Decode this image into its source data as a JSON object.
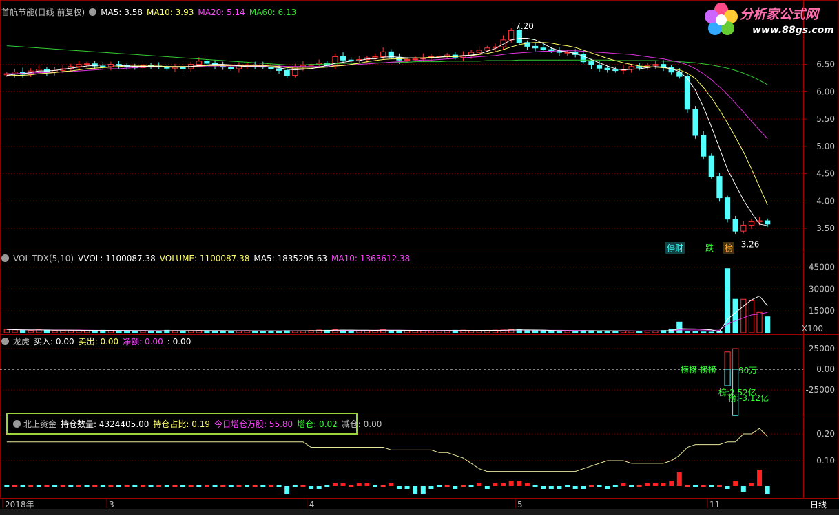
{
  "main": {
    "stock": "首航节能(日线 前复权)",
    "ma_labels": [
      {
        "text": "MA5: 3.58",
        "color": "#ffffff"
      },
      {
        "text": "MA10: 3.93",
        "color": "#ffff66"
      },
      {
        "text": "MA20: 5.14",
        "color": "#ff44ff"
      },
      {
        "text": "MA60: 6.13",
        "color": "#33dd33"
      }
    ],
    "high_label": "7.20",
    "low_label": "3.26",
    "tags": [
      {
        "text": "停财",
        "color": "#33ffff"
      },
      {
        "text": "跌",
        "color": "#33ff33"
      },
      {
        "text": "榜",
        "color": "#ffaa33"
      }
    ],
    "y_ticks": [
      "6.50",
      "6.00",
      "5.50",
      "5.00",
      "4.50",
      "4.00",
      "3.50"
    ]
  },
  "volume": {
    "title": "VOL-TDX(5,10)",
    "labels": [
      {
        "text": "VVOL: 1100087.38",
        "color": "#ffffff"
      },
      {
        "text": "VOLUME: 1100087.38",
        "color": "#ffff66"
      },
      {
        "text": "MA5: 1835295.63",
        "color": "#ffffff"
      },
      {
        "text": "MA10: 1363612.38",
        "color": "#ff44ff"
      }
    ],
    "y_ticks": [
      "45000",
      "30000",
      "15000"
    ],
    "unit": "X100"
  },
  "longhu": {
    "title": "龙虎",
    "labels": [
      {
        "text": "买入: 0.00",
        "color": "#ffffff"
      },
      {
        "text": "卖出: 0.00",
        "color": "#ffff66"
      },
      {
        "text": "净额: 0.00",
        "color": "#ff44ff"
      },
      {
        "text": ": 0.00",
        "color": "#ffffff"
      }
    ],
    "y_ticks": [
      "25000",
      "0.00",
      "-25000"
    ],
    "annotations": [
      {
        "text": "榜:2.52亿",
        "color": "#33ff33"
      },
      {
        "text": "榜:-3.12亿",
        "color": "#33ff33"
      },
      {
        "text": "榜榜 榜榜",
        "color": "#33ff33"
      },
      {
        "text": "90万",
        "color": "#33ff33"
      }
    ]
  },
  "north": {
    "title": "北上资金",
    "labels": [
      {
        "text": "持仓数量: 4324405.00",
        "color": "#ffffff"
      },
      {
        "text": "持仓占比: 0.19",
        "color": "#ffff66"
      },
      {
        "text": "今日增仓万股: 55.80",
        "color": "#ff44ff"
      },
      {
        "text": "增仓: 0.02",
        "color": "#33ff33"
      },
      {
        "text": "减仓: 0.00",
        "color": "#c0c0c0"
      }
    ],
    "y_ticks": [
      "0.20",
      "0.10"
    ]
  },
  "x_axis": {
    "labels": [
      {
        "text": "2018年",
        "day": 0
      },
      {
        "text": "3",
        "day": 13
      },
      {
        "text": "4",
        "day": 38
      },
      {
        "text": "5",
        "day": 64
      },
      {
        "text": "11",
        "day": 88
      }
    ],
    "period": "日线"
  },
  "logo": {
    "name": "分析家公式网",
    "url": "www.88gs.com"
  },
  "chart_data": {
    "type": "candlestick",
    "title": "首航节能(日线 前复权)",
    "ylim": [
      3.15,
      7.3
    ],
    "close": [
      6.33,
      6.36,
      6.32,
      6.38,
      6.41,
      6.36,
      6.39,
      6.42,
      6.46,
      6.5,
      6.51,
      6.47,
      6.46,
      6.5,
      6.48,
      6.45,
      6.44,
      6.48,
      6.47,
      6.46,
      6.43,
      6.45,
      6.42,
      6.5,
      6.56,
      6.52,
      6.47,
      6.45,
      6.42,
      6.47,
      6.49,
      6.47,
      6.45,
      6.42,
      6.39,
      6.3,
      6.45,
      6.48,
      6.5,
      6.52,
      6.48,
      6.64,
      6.58,
      6.57,
      6.59,
      6.62,
      6.64,
      6.73,
      6.63,
      6.58,
      6.59,
      6.6,
      6.62,
      6.64,
      6.65,
      6.67,
      6.63,
      6.66,
      6.72,
      6.76,
      6.8,
      6.82,
      6.95,
      7.12,
      6.9,
      6.83,
      6.8,
      6.77,
      6.75,
      6.72,
      6.72,
      6.68,
      6.55,
      6.49,
      6.43,
      6.4,
      6.39,
      6.41,
      6.46,
      6.44,
      6.48,
      6.5,
      6.44,
      6.36,
      6.28,
      5.68,
      5.2,
      4.82,
      4.45,
      4.06,
      3.67,
      3.45,
      3.56,
      3.62,
      3.64,
      3.58
    ],
    "volume_x100": [
      2300,
      2000,
      1800,
      1600,
      2100,
      1900,
      1500,
      1700,
      1600,
      1800,
      1500,
      1400,
      1700,
      1600,
      1500,
      1400,
      1300,
      1500,
      1400,
      1300,
      1700,
      1500,
      1400,
      1500,
      1600,
      1500,
      1400,
      1300,
      1200,
      1400,
      1500,
      1300,
      1200,
      1300,
      1200,
      1500,
      1300,
      1400,
      1600,
      1900,
      1700,
      2100,
      1800,
      1700,
      1600,
      1500,
      1700,
      2200,
      1600,
      1500,
      1400,
      1500,
      1600,
      1400,
      1500,
      1600,
      1700,
      1800,
      1500,
      1600,
      1700,
      1800,
      1900,
      2300,
      2100,
      1700,
      1500,
      1400,
      1300,
      1200,
      1300,
      1400,
      1600,
      1500,
      1400,
      1200,
      1100,
      1300,
      1200,
      1100,
      1300,
      1200,
      1600,
      2600,
      7400,
      900,
      700,
      600,
      500,
      800,
      44000,
      23000,
      23000,
      22000,
      14000,
      11000
    ],
    "ma5": [
      6.3,
      6.32,
      6.33,
      6.35,
      6.38,
      6.38,
      6.39,
      6.41,
      6.43,
      6.45,
      6.47,
      6.48,
      6.49,
      6.49,
      6.48,
      6.47,
      6.46,
      6.46,
      6.46,
      6.46,
      6.45,
      6.45,
      6.45,
      6.46,
      6.48,
      6.49,
      6.5,
      6.5,
      6.49,
      6.47,
      6.46,
      6.46,
      6.46,
      6.45,
      6.44,
      6.41,
      6.4,
      6.41,
      6.42,
      6.45,
      6.48,
      6.52,
      6.54,
      6.56,
      6.57,
      6.6,
      6.6,
      6.63,
      6.64,
      6.63,
      6.62,
      6.62,
      6.61,
      6.62,
      6.63,
      6.65,
      6.65,
      6.66,
      6.67,
      6.69,
      6.74,
      6.79,
      6.87,
      6.95,
      6.98,
      6.98,
      6.95,
      6.88,
      6.8,
      6.75,
      6.73,
      6.7,
      6.65,
      6.59,
      6.53,
      6.47,
      6.42,
      6.4,
      6.41,
      6.42,
      6.44,
      6.46,
      6.45,
      6.42,
      6.37,
      6.24,
      6.03,
      5.72,
      5.36,
      4.97,
      4.58,
      4.3,
      4.02,
      3.79,
      3.58,
      3.55
    ],
    "ma10": [
      6.29,
      6.3,
      6.3,
      6.31,
      6.33,
      6.34,
      6.35,
      6.37,
      6.38,
      6.4,
      6.42,
      6.43,
      6.44,
      6.45,
      6.46,
      6.47,
      6.47,
      6.47,
      6.47,
      6.47,
      6.46,
      6.46,
      6.46,
      6.46,
      6.47,
      6.48,
      6.48,
      6.48,
      6.48,
      6.48,
      6.48,
      6.48,
      6.48,
      6.47,
      6.46,
      6.44,
      6.43,
      6.43,
      6.43,
      6.44,
      6.45,
      6.47,
      6.48,
      6.5,
      6.52,
      6.55,
      6.57,
      6.59,
      6.6,
      6.6,
      6.61,
      6.62,
      6.62,
      6.63,
      6.63,
      6.64,
      6.64,
      6.65,
      6.66,
      6.68,
      6.7,
      6.73,
      6.77,
      6.82,
      6.86,
      6.89,
      6.9,
      6.9,
      6.89,
      6.86,
      6.84,
      6.81,
      6.76,
      6.71,
      6.66,
      6.61,
      6.57,
      6.53,
      6.5,
      6.47,
      6.46,
      6.45,
      6.44,
      6.42,
      6.4,
      6.34,
      6.24,
      6.08,
      5.89,
      5.67,
      5.43,
      5.17,
      4.9,
      4.59,
      4.26,
      3.93
    ],
    "ma20": [
      6.33,
      6.33,
      6.34,
      6.34,
      6.35,
      6.35,
      6.36,
      6.36,
      6.37,
      6.38,
      6.39,
      6.4,
      6.41,
      6.42,
      6.42,
      6.43,
      6.44,
      6.45,
      6.45,
      6.45,
      6.46,
      6.46,
      6.46,
      6.46,
      6.46,
      6.47,
      6.47,
      6.47,
      6.47,
      6.47,
      6.47,
      6.47,
      6.47,
      6.47,
      6.47,
      6.46,
      6.46,
      6.46,
      6.46,
      6.46,
      6.47,
      6.47,
      6.48,
      6.49,
      6.5,
      6.51,
      6.52,
      6.53,
      6.54,
      6.55,
      6.56,
      6.57,
      6.58,
      6.58,
      6.59,
      6.6,
      6.61,
      6.62,
      6.63,
      6.64,
      6.65,
      6.66,
      6.68,
      6.7,
      6.71,
      6.72,
      6.73,
      6.74,
      6.74,
      6.75,
      6.75,
      6.75,
      6.74,
      6.73,
      6.72,
      6.71,
      6.7,
      6.69,
      6.68,
      6.66,
      6.64,
      6.62,
      6.6,
      6.57,
      6.54,
      6.49,
      6.42,
      6.33,
      6.22,
      6.09,
      5.95,
      5.79,
      5.63,
      5.46,
      5.3,
      5.14
    ],
    "ma60": [
      6.84,
      6.83,
      6.82,
      6.81,
      6.8,
      6.79,
      6.78,
      6.77,
      6.76,
      6.75,
      6.74,
      6.73,
      6.72,
      6.71,
      6.7,
      6.69,
      6.68,
      6.67,
      6.66,
      6.65,
      6.64,
      6.63,
      6.62,
      6.61,
      6.6,
      6.59,
      6.58,
      6.57,
      6.56,
      6.55,
      6.54,
      6.53,
      6.52,
      6.51,
      6.5,
      6.49,
      6.49,
      6.49,
      6.5,
      6.5,
      6.51,
      6.51,
      6.52,
      6.52,
      6.52,
      6.53,
      6.53,
      6.53,
      6.54,
      6.54,
      6.54,
      6.55,
      6.55,
      6.55,
      6.55,
      6.56,
      6.56,
      6.56,
      6.56,
      6.56,
      6.57,
      6.57,
      6.57,
      6.57,
      6.58,
      6.58,
      6.58,
      6.58,
      6.58,
      6.58,
      6.58,
      6.58,
      6.58,
      6.58,
      6.58,
      6.58,
      6.57,
      6.57,
      6.57,
      6.57,
      6.57,
      6.57,
      6.56,
      6.56,
      6.55,
      6.54,
      6.53,
      6.51,
      6.49,
      6.46,
      6.43,
      6.39,
      6.34,
      6.28,
      6.21,
      6.13
    ],
    "north_ratio": [
      0.17,
      0.17,
      0.17,
      0.17,
      0.17,
      0.17,
      0.17,
      0.17,
      0.17,
      0.17,
      0.17,
      0.17,
      0.17,
      0.17,
      0.17,
      0.17,
      0.17,
      0.17,
      0.17,
      0.17,
      0.17,
      0.17,
      0.17,
      0.17,
      0.17,
      0.17,
      0.17,
      0.17,
      0.17,
      0.17,
      0.17,
      0.17,
      0.17,
      0.17,
      0.17,
      0.17,
      0.17,
      0.17,
      0.15,
      0.15,
      0.15,
      0.15,
      0.15,
      0.15,
      0.15,
      0.15,
      0.15,
      0.15,
      0.14,
      0.14,
      0.14,
      0.14,
      0.14,
      0.14,
      0.13,
      0.13,
      0.12,
      0.11,
      0.09,
      0.07,
      0.06,
      0.06,
      0.06,
      0.06,
      0.06,
      0.06,
      0.06,
      0.06,
      0.06,
      0.06,
      0.06,
      0.06,
      0.07,
      0.08,
      0.09,
      0.1,
      0.1,
      0.1,
      0.09,
      0.09,
      0.09,
      0.09,
      0.09,
      0.1,
      0.12,
      0.15,
      0.16,
      0.16,
      0.16,
      0.16,
      0.17,
      0.17,
      0.2,
      0.2,
      0.22,
      0.19
    ],
    "north_flow": [
      0,
      0,
      0,
      0,
      0,
      0,
      0,
      0,
      0,
      0,
      0,
      0,
      0,
      0,
      0,
      0,
      0,
      0,
      0,
      0,
      0,
      0,
      0,
      0,
      0,
      0,
      0,
      0,
      0,
      0,
      0,
      0,
      0,
      0,
      0,
      -3,
      0,
      0,
      -1,
      -1,
      0,
      1,
      1,
      0,
      1,
      1,
      0,
      0,
      1,
      -1,
      -1,
      -3,
      -3,
      -1,
      0,
      0,
      -1,
      0,
      0,
      1,
      -1,
      1,
      1,
      2,
      2,
      1,
      0,
      -1,
      -1,
      -1,
      0,
      -1,
      -1,
      0,
      0,
      -1,
      0,
      1,
      0,
      0,
      1,
      1,
      1,
      2,
      5,
      0,
      0,
      0,
      0,
      0,
      -1,
      2,
      -2,
      1,
      6,
      -3,
      3
    ]
  }
}
